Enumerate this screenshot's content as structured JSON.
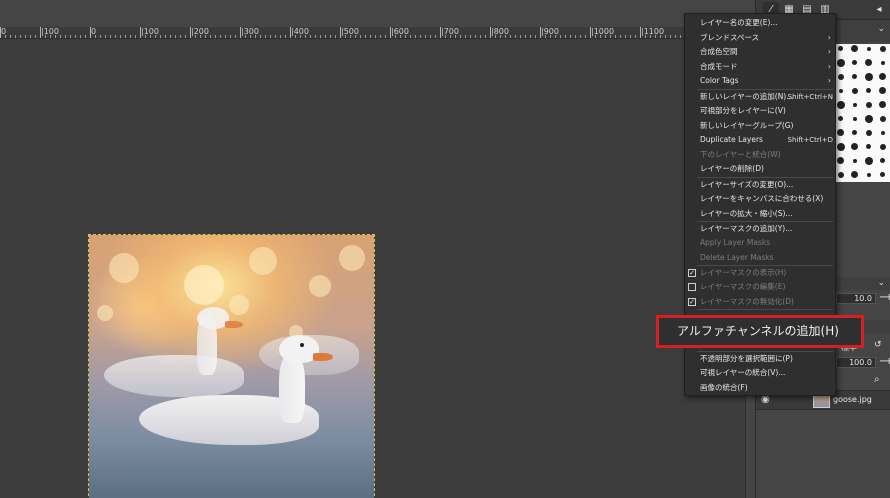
{
  "ruler": {
    "labels": [
      "0",
      "|100",
      "0",
      "|100",
      "|200",
      "|300",
      "|400",
      "|500",
      "|600",
      "|700",
      "|800",
      "|900",
      "|1000",
      "|1100",
      "|"
    ]
  },
  "image": {
    "alt": "goose photo"
  },
  "dock": {
    "value_size": "10.0",
    "value_opacity": "100.0",
    "mode_label": "標準",
    "layer_name": "goose.jpg"
  },
  "menu": {
    "items": [
      {
        "label": "レイヤー名の変更(E)...",
        "shortcut": "",
        "submenu": false,
        "disabled": false,
        "check": null
      },
      {
        "label": "ブレンドスペース",
        "shortcut": "",
        "submenu": true,
        "disabled": false,
        "check": null
      },
      {
        "label": "合成色空間",
        "shortcut": "",
        "submenu": true,
        "disabled": false,
        "check": null
      },
      {
        "label": "合成モード",
        "shortcut": "",
        "submenu": true,
        "disabled": false,
        "check": null
      },
      {
        "label": "Color Tags",
        "shortcut": "",
        "submenu": true,
        "disabled": false,
        "check": null
      },
      {
        "label": "新しいレイヤーの追加(N)...",
        "shortcut": "Shift+Ctrl+N",
        "submenu": false,
        "disabled": false,
        "check": null
      },
      {
        "label": "可視部分をレイヤーに(V)",
        "shortcut": "",
        "submenu": false,
        "disabled": false,
        "check": null
      },
      {
        "label": "新しいレイヤーグループ(G)",
        "shortcut": "",
        "submenu": false,
        "disabled": false,
        "check": null
      },
      {
        "label": "Duplicate Layers",
        "shortcut": "Shift+Ctrl+D",
        "submenu": false,
        "disabled": false,
        "check": null
      },
      {
        "label": "下のレイヤーと統合(W)",
        "shortcut": "",
        "submenu": false,
        "disabled": true,
        "check": null
      },
      {
        "label": "レイヤーの削除(D)",
        "shortcut": "",
        "submenu": false,
        "disabled": false,
        "check": null
      },
      {
        "label": "レイヤーサイズの変更(O)...",
        "shortcut": "",
        "submenu": false,
        "disabled": false,
        "check": null
      },
      {
        "label": "レイヤーをキャンバスに合わせる(X)",
        "shortcut": "",
        "submenu": false,
        "disabled": false,
        "check": null
      },
      {
        "label": "レイヤーの拡大・縮小(S)...",
        "shortcut": "",
        "submenu": false,
        "disabled": false,
        "check": null
      },
      {
        "label": "レイヤーマスクの追加(Y)...",
        "shortcut": "",
        "submenu": false,
        "disabled": false,
        "check": null
      },
      {
        "label": "Apply Layer Masks",
        "shortcut": "",
        "submenu": false,
        "disabled": true,
        "check": null
      },
      {
        "label": "Delete Layer Masks",
        "shortcut": "",
        "submenu": false,
        "disabled": true,
        "check": null
      },
      {
        "label": "レイヤーマスクの表示(H)",
        "shortcut": "",
        "submenu": false,
        "disabled": true,
        "check": true
      },
      {
        "label": "レイヤーマスクの編集(E)",
        "shortcut": "",
        "submenu": false,
        "disabled": true,
        "check": false
      },
      {
        "label": "レイヤーマスクの無効化(D)",
        "shortcut": "",
        "submenu": false,
        "disabled": true,
        "check": true
      },
      {
        "label": "不透明部分を選択範囲に(P)",
        "shortcut": "",
        "submenu": false,
        "disabled": false,
        "check": null
      },
      {
        "label": "可視レイヤーの統合(V)...",
        "shortcut": "",
        "submenu": false,
        "disabled": false,
        "check": null
      },
      {
        "label": "画像の統合(F)",
        "shortcut": "",
        "submenu": false,
        "disabled": false,
        "check": null
      }
    ]
  },
  "callout": {
    "label": "アルファチャンネルの追加(H)"
  }
}
